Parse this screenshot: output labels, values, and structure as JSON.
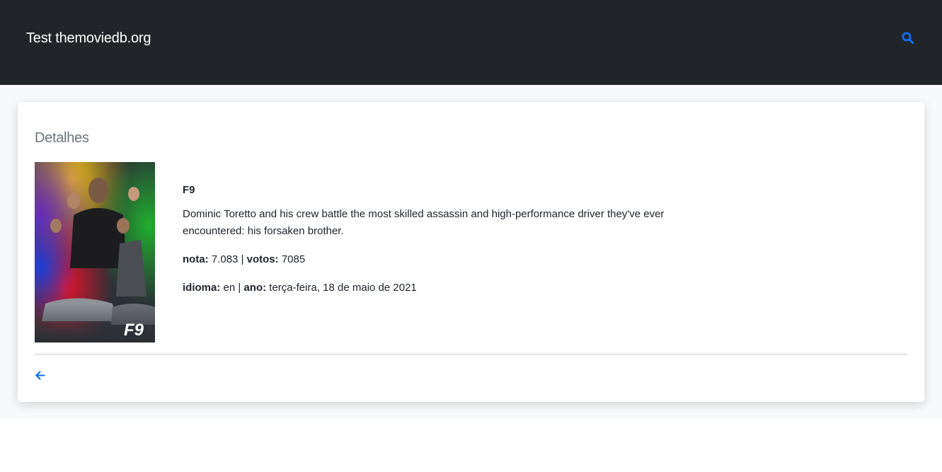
{
  "navbar": {
    "brand": "Test themoviedb.org",
    "search_icon": "search-icon"
  },
  "card": {
    "title": "Detalhes",
    "movie": {
      "title": "F9",
      "overview": "Dominic Toretto and his crew battle the most skilled assassin and high-performance driver they've ever encountered: his forsaken brother.",
      "rating_label": "nota:",
      "rating": "7.083",
      "votes_label": "votos:",
      "votes": "7085",
      "language_label": "idioma:",
      "language": "en",
      "year_label": "ano:",
      "release_date": "terça-feira, 18 de maio de 2021",
      "separator": "|",
      "poster_text": "F9"
    },
    "back_icon": "arrow-left-icon"
  },
  "colors": {
    "navbar_bg": "#212529",
    "accent": "#0d6efd",
    "page_bg": "#f8f9fa"
  }
}
